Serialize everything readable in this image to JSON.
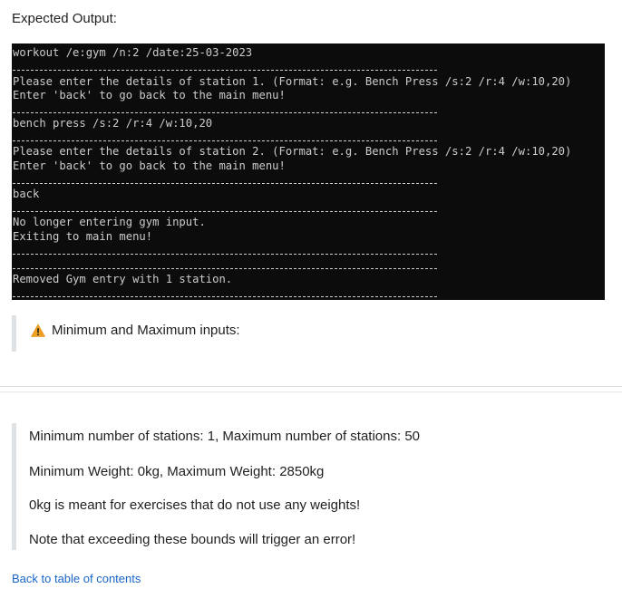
{
  "expected_output_label": "Expected Output:",
  "terminal": {
    "lines": [
      "workout /e:gym /n:2 /date:25-03-2023",
      "Please enter the details of station 1. (Format: e.g. Bench Press /s:2 /r:4 /w:10,20)",
      "Enter 'back' to go back to the main menu!",
      "bench press /s:2 /r:4 /w:10,20",
      "Please enter the details of station 2. (Format: e.g. Bench Press /s:2 /r:4 /w:10,20)",
      "Enter 'back' to go back to the main menu!",
      "back",
      "No longer entering gym input.",
      "Exiting to main menu!",
      "Removed Gym entry with 1 station."
    ]
  },
  "warning_callout": {
    "icon": "warning-icon",
    "text": "Minimum and Maximum inputs:"
  },
  "notes": [
    "Minimum number of stations: 1, Maximum number of stations: 50",
    "Minimum Weight: 0kg, Maximum Weight: 2850kg",
    "0kg is meant for exercises that do not use any weights!",
    "Note that exceeding these bounds will trigger an error!"
  ],
  "back_link": "Back to table of contents",
  "colors": {
    "terminal_bg": "#0c0c0c",
    "terminal_text": "#cccccc",
    "link": "#1a66c9",
    "warning": "#f0a020"
  }
}
